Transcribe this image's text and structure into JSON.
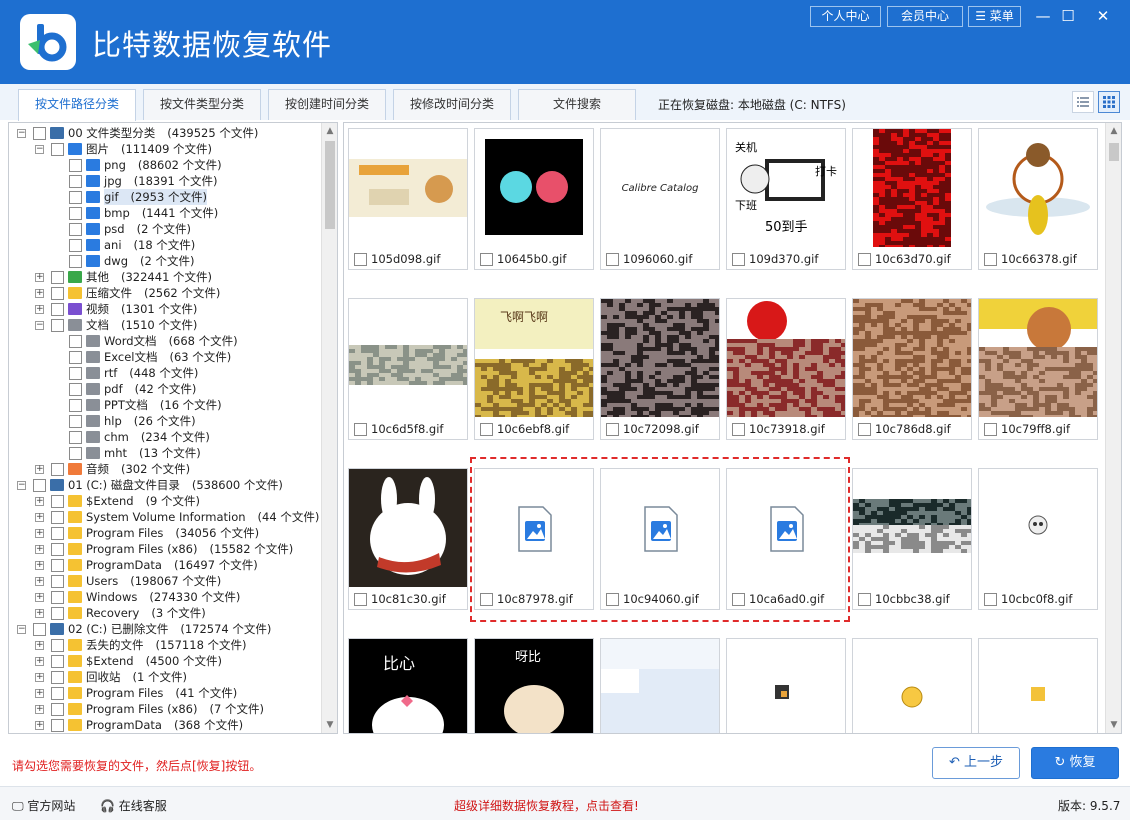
{
  "app": {
    "title": "比特数据恢复软件",
    "personal_center": "个人中心",
    "member_center": "会员中心",
    "menu": "菜单"
  },
  "tabs": [
    "按文件路径分类",
    "按文件类型分类",
    "按创建时间分类",
    "按修改时间分类",
    "文件搜索"
  ],
  "disk_status": "正在恢复磁盘: 本地磁盘 (C: NTFS)",
  "tree": [
    {
      "level": 0,
      "exp": "−",
      "icon": "drive-icon",
      "label": "00 文件类型分类",
      "count": "(439525 个文件)"
    },
    {
      "level": 1,
      "exp": "−",
      "icon": "image-icon",
      "label": "图片",
      "count": "(111409 个文件)"
    },
    {
      "level": 2,
      "exp": "",
      "icon": "image-icon",
      "label": "png",
      "count": "(88602 个文件)"
    },
    {
      "level": 2,
      "exp": "",
      "icon": "image-icon",
      "label": "jpg",
      "count": "(18391 个文件)"
    },
    {
      "level": 2,
      "exp": "",
      "icon": "image-icon",
      "label": "gif",
      "count": "(2953 个文件)",
      "selected": true
    },
    {
      "level": 2,
      "exp": "",
      "icon": "image-icon",
      "label": "bmp",
      "count": "(1441 个文件)"
    },
    {
      "level": 2,
      "exp": "",
      "icon": "image-icon",
      "label": "psd",
      "count": "(2 个文件)"
    },
    {
      "level": 2,
      "exp": "",
      "icon": "image-icon",
      "label": "ani",
      "count": "(18 个文件)"
    },
    {
      "level": 2,
      "exp": "",
      "icon": "image-icon",
      "label": "dwg",
      "count": "(2 个文件)"
    },
    {
      "level": 1,
      "exp": "+",
      "icon": "green-folder-icon",
      "label": "其他",
      "count": "(322441 个文件)"
    },
    {
      "level": 1,
      "exp": "+",
      "icon": "folder-icon",
      "label": "压缩文件",
      "count": "(2562 个文件)"
    },
    {
      "level": 1,
      "exp": "+",
      "icon": "video-icon",
      "label": "视频",
      "count": "(1301 个文件)"
    },
    {
      "level": 1,
      "exp": "−",
      "icon": "doc-icon",
      "label": "文档",
      "count": "(1510 个文件)"
    },
    {
      "level": 2,
      "exp": "",
      "icon": "doc-icon",
      "label": "Word文档",
      "count": "(668 个文件)"
    },
    {
      "level": 2,
      "exp": "",
      "icon": "doc-icon",
      "label": "Excel文档",
      "count": "(63 个文件)"
    },
    {
      "level": 2,
      "exp": "",
      "icon": "doc-icon",
      "label": "rtf",
      "count": "(448 个文件)"
    },
    {
      "level": 2,
      "exp": "",
      "icon": "doc-icon",
      "label": "pdf",
      "count": "(42 个文件)"
    },
    {
      "level": 2,
      "exp": "",
      "icon": "doc-icon",
      "label": "PPT文档",
      "count": "(16 个文件)"
    },
    {
      "level": 2,
      "exp": "",
      "icon": "doc-icon",
      "label": "hlp",
      "count": "(26 个文件)"
    },
    {
      "level": 2,
      "exp": "",
      "icon": "doc-icon",
      "label": "chm",
      "count": "(234 个文件)"
    },
    {
      "level": 2,
      "exp": "",
      "icon": "doc-icon",
      "label": "mht",
      "count": "(13 个文件)"
    },
    {
      "level": 1,
      "exp": "+",
      "icon": "audio-icon",
      "label": "音频",
      "count": "(302 个文件)"
    },
    {
      "level": 0,
      "exp": "−",
      "icon": "drive-icon",
      "label": "01 (C:) 磁盘文件目录",
      "count": "(538600 个文件)"
    },
    {
      "level": 1,
      "exp": "+",
      "icon": "folder-icon",
      "label": "$Extend",
      "count": "(9 个文件)"
    },
    {
      "level": 1,
      "exp": "+",
      "icon": "folder-icon",
      "label": "System Volume Information",
      "count": "(44 个文件)"
    },
    {
      "level": 1,
      "exp": "+",
      "icon": "folder-icon",
      "label": "Program Files",
      "count": "(34056 个文件)"
    },
    {
      "level": 1,
      "exp": "+",
      "icon": "folder-icon",
      "label": "Program Files (x86)",
      "count": "(15582 个文件)"
    },
    {
      "level": 1,
      "exp": "+",
      "icon": "folder-icon",
      "label": "ProgramData",
      "count": "(16497 个文件)"
    },
    {
      "level": 1,
      "exp": "+",
      "icon": "folder-icon",
      "label": "Users",
      "count": "(198067 个文件)"
    },
    {
      "level": 1,
      "exp": "+",
      "icon": "folder-icon",
      "label": "Windows",
      "count": "(274330 个文件)"
    },
    {
      "level": 1,
      "exp": "+",
      "icon": "folder-icon",
      "label": "Recovery",
      "count": "(3 个文件)"
    },
    {
      "level": 0,
      "exp": "−",
      "icon": "drive-icon",
      "label": "02 (C:) 已删除文件",
      "count": "(172574 个文件)"
    },
    {
      "level": 1,
      "exp": "+",
      "icon": "folder-icon",
      "label": "丢失的文件",
      "count": "(157118 个文件)"
    },
    {
      "level": 1,
      "exp": "+",
      "icon": "folder-icon",
      "label": "$Extend",
      "count": "(4500 个文件)"
    },
    {
      "level": 1,
      "exp": "+",
      "icon": "folder-icon",
      "label": "回收站",
      "count": "(1 个文件)"
    },
    {
      "level": 1,
      "exp": "+",
      "icon": "folder-icon",
      "label": "Program Files",
      "count": "(41 个文件)"
    },
    {
      "level": 1,
      "exp": "+",
      "icon": "folder-icon",
      "label": "Program Files (x86)",
      "count": "(7 个文件)"
    },
    {
      "level": 1,
      "exp": "+",
      "icon": "folder-icon",
      "label": "ProgramData",
      "count": "(368 个文件)"
    }
  ],
  "files": [
    {
      "name": "105d098.gif",
      "thumb": "cartoon-banner"
    },
    {
      "name": "10645b0.gif",
      "thumb": "two-dots"
    },
    {
      "name": "1096060.gif",
      "thumb": "calibre",
      "caption": "Calibre Catalog"
    },
    {
      "name": "109d370.gif",
      "thumb": "meme",
      "t1": "关机",
      "t2": "打卡",
      "t3": "下班",
      "t4": "50到手"
    },
    {
      "name": "10c63d70.gif",
      "thumb": "red-noise"
    },
    {
      "name": "10c66378.gif",
      "thumb": "tiger"
    },
    {
      "name": "10c6d5f8.gif",
      "thumb": "noise-light"
    },
    {
      "name": "10c6ebf8.gif",
      "thumb": "noise-yellow",
      "t1": "飞啊飞啊"
    },
    {
      "name": "10c72098.gif",
      "thumb": "noise-dark"
    },
    {
      "name": "10c73918.gif",
      "thumb": "noise-red"
    },
    {
      "name": "10c786d8.gif",
      "thumb": "noise-brown"
    },
    {
      "name": "10c79ff8.gif",
      "thumb": "noise-face"
    },
    {
      "name": "10c81c30.gif",
      "thumb": "rabbit"
    },
    {
      "name": "10c87978.gif",
      "thumb": "placeholder"
    },
    {
      "name": "10c94060.gif",
      "thumb": "placeholder"
    },
    {
      "name": "10ca6ad0.gif",
      "thumb": "placeholder"
    },
    {
      "name": "10cbbc38.gif",
      "thumb": "noise-strip"
    },
    {
      "name": "10cbc0f8.gif",
      "thumb": "skull"
    },
    {
      "name": "",
      "thumb": "bixin",
      "t1": "比心"
    },
    {
      "name": "",
      "thumb": "yabi",
      "t1": "呀比"
    },
    {
      "name": "",
      "thumb": "light-ui"
    },
    {
      "name": "",
      "thumb": "small-hammer"
    },
    {
      "name": "",
      "thumb": "small-smile"
    },
    {
      "name": "",
      "thumb": "small-hand"
    }
  ],
  "hint": "请勾选您需要恢复的文件，然后点[恢复]按钮。",
  "buttons": {
    "back": "上一步",
    "recover": "恢复"
  },
  "bottom": {
    "website": "官方网站",
    "service": "在线客服",
    "tutorial": "超级详细数据恢复教程，点击查看!",
    "version": "版本: 9.5.7"
  }
}
